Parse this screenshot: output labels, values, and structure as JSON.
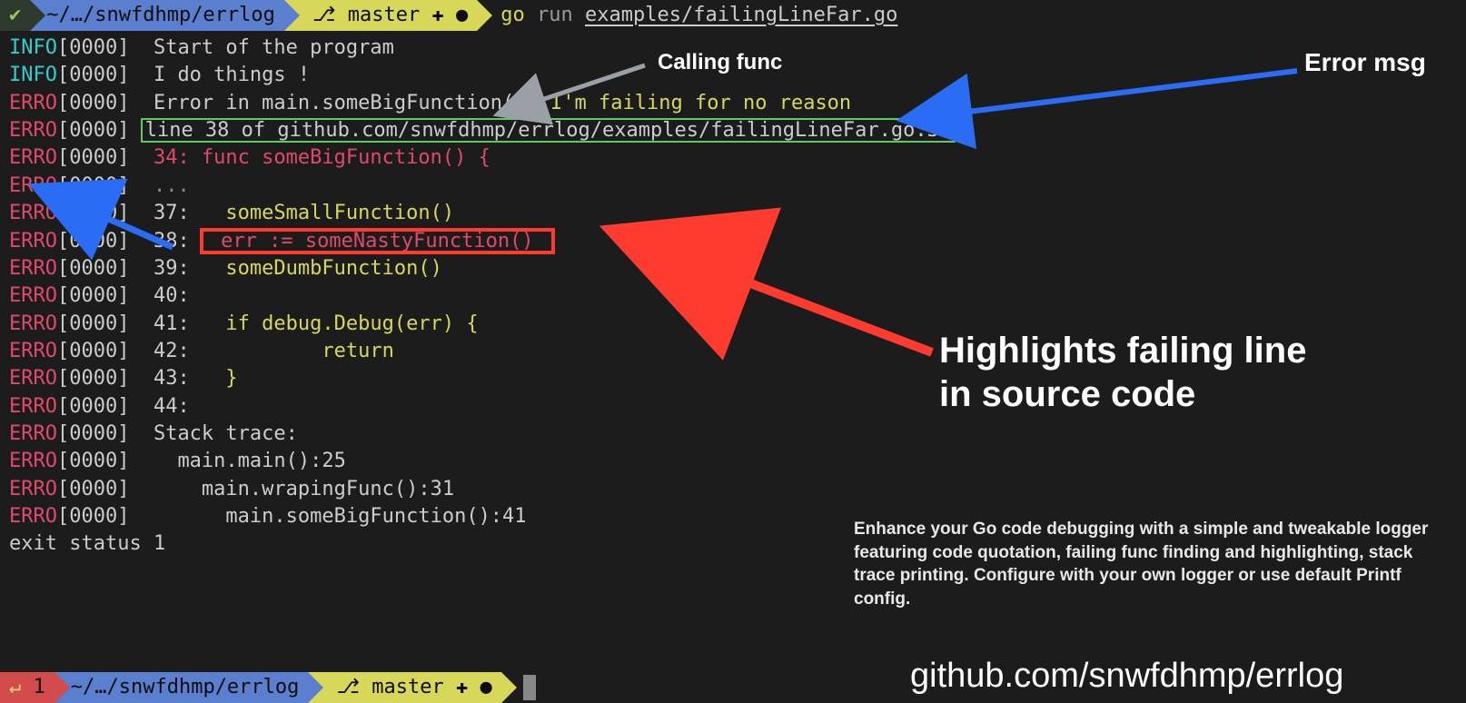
{
  "prompt_top": {
    "check": "✔",
    "path": "~/…/snwfdhmp/errlog",
    "branch_icon": "⎇",
    "branch": "master",
    "branch_plus": "✚",
    "branch_dot": "●",
    "cmd_go": "go",
    "cmd_run": "run",
    "cmd_path": "examples/failingLineFar.go"
  },
  "lines": [
    {
      "lvl": "INFO",
      "ts": "[0000]",
      "seg": [
        {
          "c": "msg",
          "t": " Start of the program"
        }
      ]
    },
    {
      "lvl": "INFO",
      "ts": "[0000]",
      "seg": [
        {
          "c": "msg",
          "t": " I do things !"
        }
      ]
    },
    {
      "lvl": "ERRO",
      "ts": "[0000]",
      "seg": [
        {
          "c": "msg",
          "t": " Error in main.someBigFunction(): "
        },
        {
          "c": "msg-yellow",
          "t": "I'm failing for no reason"
        }
      ]
    },
    {
      "lvl": "ERRO",
      "ts": "[0000]",
      "box": "green",
      "seg": [
        {
          "c": "msg",
          "t": "line 38 of github.com/snwfdhmp/errlog/examples/failingLineFar.go:38"
        }
      ]
    },
    {
      "lvl": "ERRO",
      "ts": "[0000]",
      "seg": [
        {
          "c": "msg-red",
          "t": " 34: func someBigFunction() {"
        }
      ]
    },
    {
      "lvl": "ERRO",
      "ts": "[0000]",
      "seg": [
        {
          "c": "msg-dim",
          "t": " ..."
        }
      ]
    },
    {
      "lvl": "ERRO",
      "ts": "[0000]",
      "seg": [
        {
          "c": "msg",
          "t": " 37: "
        },
        {
          "c": "msg-yellow",
          "t": "  someSmallFunction()"
        }
      ]
    },
    {
      "lvl": "ERRO",
      "ts": "[0000]",
      "seg": [
        {
          "c": "msg",
          "t": " 38: "
        }
      ],
      "boxafter": "red",
      "boxseg": [
        {
          "c": "msg-red",
          "t": " err := someNastyFunction() "
        }
      ]
    },
    {
      "lvl": "ERRO",
      "ts": "[0000]",
      "seg": [
        {
          "c": "msg",
          "t": " 39: "
        },
        {
          "c": "msg-yellow",
          "t": "  someDumbFunction()"
        }
      ]
    },
    {
      "lvl": "ERRO",
      "ts": "[0000]",
      "seg": [
        {
          "c": "msg",
          "t": " 40:"
        }
      ]
    },
    {
      "lvl": "ERRO",
      "ts": "[0000]",
      "seg": [
        {
          "c": "msg",
          "t": " 41: "
        },
        {
          "c": "msg-yellow",
          "t": "  if debug.Debug(err) {"
        }
      ]
    },
    {
      "lvl": "ERRO",
      "ts": "[0000]",
      "seg": [
        {
          "c": "msg",
          "t": " 42: "
        },
        {
          "c": "msg-yellow",
          "t": "          return"
        }
      ]
    },
    {
      "lvl": "ERRO",
      "ts": "[0000]",
      "seg": [
        {
          "c": "msg",
          "t": " 43: "
        },
        {
          "c": "msg-yellow",
          "t": "  }"
        }
      ]
    },
    {
      "lvl": "ERRO",
      "ts": "[0000]",
      "seg": [
        {
          "c": "msg",
          "t": " 44:"
        }
      ]
    },
    {
      "lvl": "ERRO",
      "ts": "[0000]",
      "seg": [
        {
          "c": "msg",
          "t": " Stack trace:"
        }
      ]
    },
    {
      "lvl": "ERRO",
      "ts": "[0000]",
      "seg": [
        {
          "c": "msg",
          "t": "   main.main():25"
        }
      ]
    },
    {
      "lvl": "ERRO",
      "ts": "[0000]",
      "seg": [
        {
          "c": "msg",
          "t": "     main.wrapingFunc():31"
        }
      ]
    },
    {
      "lvl": "ERRO",
      "ts": "[0000]",
      "seg": [
        {
          "c": "msg",
          "t": "       main.someBigFunction():41"
        }
      ]
    }
  ],
  "exit": "exit status 1",
  "prompt_bottom": {
    "err_icon": "↵",
    "err_code": "1",
    "path": "~/…/snwfdhmp/errlog",
    "branch_icon": "⎇",
    "branch": "master",
    "branch_plus": "✚",
    "branch_dot": "●"
  },
  "annotations": {
    "calling_func": "Calling func",
    "error_msg": "Error msg",
    "highlight": "Highlights failing line\nin source code",
    "desc": "Enhance your Go code debugging with a simple and tweakable logger featuring code quotation, failing func finding and highlighting, stack trace printing. Configure with your own logger or use default Printf config.",
    "repo": "github.com/snwfdhmp/errlog"
  }
}
